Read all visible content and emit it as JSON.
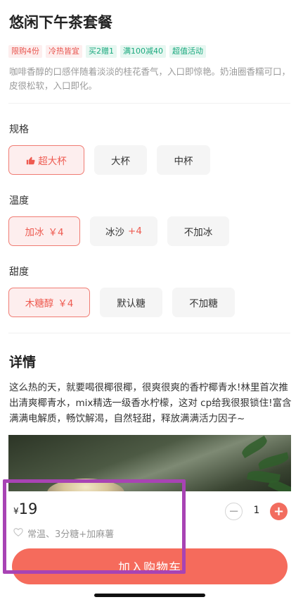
{
  "product": {
    "title": "悠闲下午茶套餐",
    "description": "咖啡香醇的口感伴随着淡淡的桂花香气，入口即惊艳。奶油圈香糯可口，皮很松软，入口即化。"
  },
  "tags": [
    {
      "label": "限购4份",
      "color": "#e8554e",
      "bg": "#fdeeee"
    },
    {
      "label": "冷热皆宜",
      "color": "#e8554e",
      "bg": "#fdeeee"
    },
    {
      "label": "买2赠1",
      "color": "#1aa97e",
      "bg": "#e7f7f1"
    },
    {
      "label": "满100减40",
      "color": "#1aa97e",
      "bg": "#e7f7f1"
    },
    {
      "label": "超值活动",
      "color": "#1aa97e",
      "bg": "#e7f7f1"
    }
  ],
  "spec": {
    "label": "规格",
    "options": [
      {
        "label": "超大杯",
        "selected": true
      },
      {
        "label": "大杯",
        "selected": false
      },
      {
        "label": "中杯",
        "selected": false
      }
    ]
  },
  "temperature": {
    "label": "温度",
    "options": [
      {
        "label": "加冰",
        "price": "￥4",
        "selected": true
      },
      {
        "label": "冰沙",
        "add": "+4",
        "selected": false
      },
      {
        "label": "不加冰",
        "selected": false
      }
    ]
  },
  "sweetness": {
    "label": "甜度",
    "options": [
      {
        "label": "木糖醇",
        "price": "￥4",
        "selected": true
      },
      {
        "label": "默认糖",
        "selected": false
      },
      {
        "label": "不加糖",
        "selected": false
      }
    ]
  },
  "details": {
    "title": "详情",
    "text": "这么热的天，就要喝很椰很椰，很爽很爽的香柠椰青水!林里首次推出清爽椰青水，mix精选一级香水柠檬，这对 cp给我很狠锁住!富含满满电解质，畅饮解渴，自然轻甜，释放满满活力因子~"
  },
  "bottom_bar": {
    "currency": "¥",
    "price": "19",
    "summary": "常温、3分糖+加麻薯",
    "quantity": "1",
    "minus_label": "−",
    "plus_label": "+",
    "cart_label": "加入购物车"
  },
  "colors": {
    "accent": "#f56b5c",
    "highlight_box": "#a843b4"
  }
}
